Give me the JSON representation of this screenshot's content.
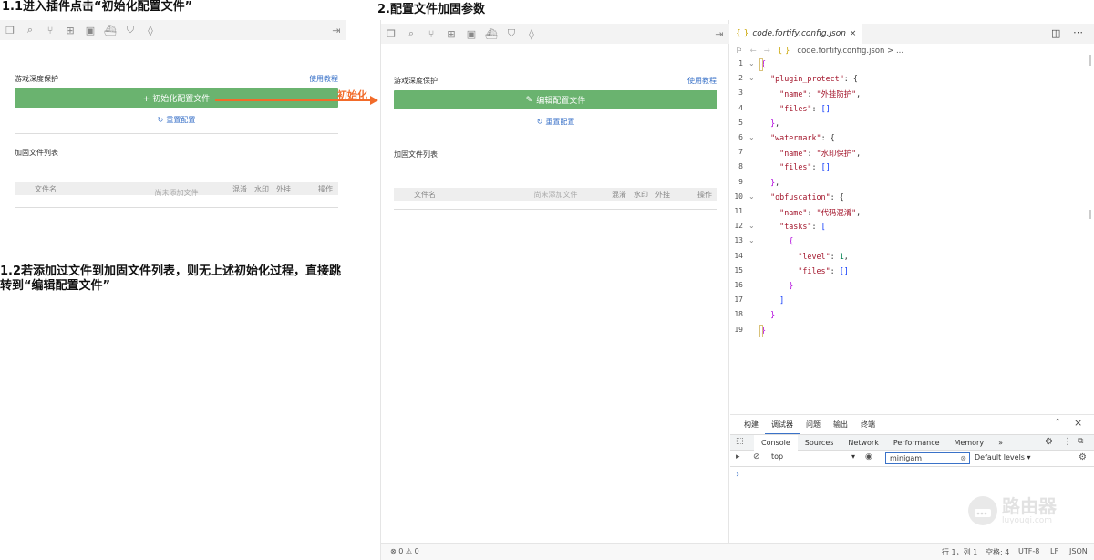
{
  "annotations": {
    "step1_title": "1.1进入插件点击“初始化配置文件”",
    "step2_title": "2.配置文件加固参数",
    "step12_note_line1": "1.2若添加过文件到加固文件列表，则无上述初始化过程，直接跳",
    "step12_note_line2": "转到“编辑配置文件”",
    "arrow_label": "初始化",
    "colors": {
      "arrow": "#f26b2a",
      "green_button": "#6ab36f",
      "link": "#3a72c8"
    }
  },
  "toolbar_icons": [
    "copy-icon",
    "search-icon",
    "source-control-icon",
    "extensions-icon",
    "image-icon",
    "docker-icon",
    "shield-icon",
    "droplet-icon"
  ],
  "panel_left": {
    "section_title": "游戏深度保护",
    "tutorial_link": "使用教程",
    "init_button": "+ 初始化配置文件",
    "reset_link": "重置配置",
    "list_title": "加固文件列表",
    "columns": [
      "文件名",
      "混淆",
      "水印",
      "外挂",
      "操作"
    ],
    "empty_text": "尚未添加文件"
  },
  "panel_right": {
    "section_title": "游戏深度保护",
    "tutorial_link": "使用教程",
    "edit_button": "编辑配置文件",
    "reset_link": "重置配置",
    "list_title": "加固文件列表",
    "columns": [
      "文件名",
      "混淆",
      "水印",
      "外挂",
      "操作"
    ],
    "empty_text": "尚未添加文件"
  },
  "editor": {
    "tab_label": "code.fortify.config.json",
    "breadcrumb": "code.fortify.config.json > ...",
    "lines": [
      "{",
      "  \"plugin_protect\": {",
      "    \"name\": \"外挂防护\",",
      "    \"files\": []",
      "  },",
      "  \"watermark\": {",
      "    \"name\": \"水印保护\",",
      "    \"files\": []",
      "  },",
      "  \"obfuscation\": {",
      "    \"name\": \"代码混淆\",",
      "    \"tasks\": [",
      "      {",
      "        \"level\": 1,",
      "        \"files\": []",
      "      }",
      "    ]",
      "  }",
      "}"
    ]
  },
  "bottom_panel": {
    "tabs": [
      "构建",
      "调试器",
      "问题",
      "输出",
      "终端"
    ],
    "active_tab": "调试器",
    "devtools_tabs": [
      "Console",
      "Sources",
      "Network",
      "Performance",
      "Memory",
      "»"
    ],
    "active_devtools_tab": "Console",
    "context": "top",
    "filter_value": "minigam",
    "levels": "Default levels ▾",
    "prompt": "›"
  },
  "status_bar": {
    "errors": "⊗ 0 ⚠ 0",
    "position": "行 1，列 1",
    "spaces": "空格: 4",
    "encoding": "UTF-8",
    "eol": "LF",
    "language": "JSON"
  },
  "watermark": {
    "brand": "路由器",
    "url": "luyouqi.com"
  }
}
